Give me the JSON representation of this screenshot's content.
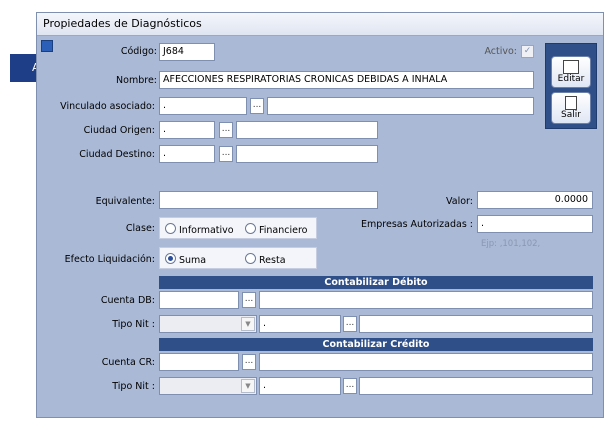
{
  "window": {
    "title": "Propiedades de Diagnósticos"
  },
  "callout": {
    "label": "A"
  },
  "form": {
    "codigo": {
      "label": "Código:",
      "value": "J684"
    },
    "activo": {
      "label": "Activo:"
    },
    "nombre": {
      "label": "Nombre:",
      "value": "AFECCIONES RESPIRATORIAS CRONICAS DEBIDAS A INHALA"
    },
    "vinculado": {
      "label": "Vinculado asociado:",
      "value": "."
    },
    "ciudad_origen": {
      "label": "Ciudad Origen:",
      "value": "."
    },
    "ciudad_destino": {
      "label": "Ciudad Destino:",
      "value": "."
    },
    "equivalente": {
      "label": "Equivalente:",
      "value": ""
    },
    "valor": {
      "label": "Valor:",
      "value": "0.0000"
    },
    "clase": {
      "label": "Clase:",
      "options": [
        "Informativo",
        "Financiero"
      ]
    },
    "empresas": {
      "label": "Empresas Autorizadas :",
      "value": ".",
      "hint": "Ejp: ,101,102,"
    },
    "efecto": {
      "label": "Efecto Liquidación:",
      "options": [
        "Suma",
        "Resta"
      ],
      "selected": "Suma"
    },
    "ellipsis": "..."
  },
  "debito": {
    "title": "Contabilizar Débito",
    "cuenta_label": "Cuenta DB:",
    "tiponit_label": "Tipo Nit :",
    "tiponit_value": "."
  },
  "credito": {
    "title": "Contabilizar Crédito",
    "cuenta_label": "Cuenta CR:",
    "tiponit_label": "Tipo Nit :",
    "tiponit_value": "."
  },
  "buttons": {
    "editar": "Editar",
    "salir": "Salir"
  },
  "colors": {
    "accent": "#2f4f89",
    "panel": "#aab9d6",
    "callout": "#1e3f87"
  }
}
